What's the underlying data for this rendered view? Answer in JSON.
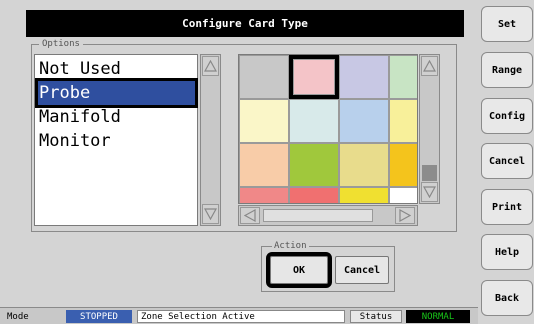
{
  "dialog": {
    "title": "Configure Card Type",
    "options_legend": "Options",
    "list_items": [
      "Not Used",
      "Probe",
      "Manifold",
      "Monitor"
    ],
    "selected_index": 1
  },
  "color_grid": {
    "rows": [
      [
        "#c8c8c8",
        "#f4c4c8",
        "#c8c8e4",
        "#c8e4c4"
      ],
      [
        "#faf6c8",
        "#d8eaea",
        "#b8d0ec",
        "#f8f09a"
      ],
      [
        "#f8cca8",
        "#a0c83c",
        "#e8dc8c",
        "#f4c41c"
      ],
      [
        "#f08888",
        "#f07070",
        "#f0e030",
        "#ffffff"
      ]
    ],
    "selected": "#f4c4c8"
  },
  "action": {
    "legend": "Action",
    "ok_label": "OK",
    "cancel_label": "Cancel"
  },
  "side_buttons": [
    "Set",
    "Range",
    "Config",
    "Cancel",
    "Print",
    "Help",
    "Back"
  ],
  "status_bar": {
    "mode_label": "Mode",
    "mode_value": "STOPPED",
    "message": "Zone Selection Active",
    "status_label": "Status",
    "status_value": "NORMAL"
  },
  "colors": {
    "selection_blue": "#2f4f9f",
    "mode_badge_bg": "#3a5fb0",
    "status_badge_bg": "#000000",
    "status_badge_text": "#19c419"
  },
  "icons": {
    "scroll_up": "triangle-up-icon",
    "scroll_down": "triangle-down-icon",
    "scroll_left": "triangle-left-icon",
    "scroll_right": "triangle-right-icon"
  }
}
